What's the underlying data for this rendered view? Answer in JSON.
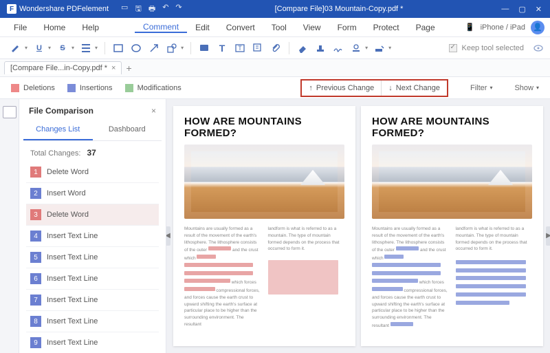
{
  "titlebar": {
    "app": "Wondershare PDFelement",
    "doc": "[Compare File]03 Mountain-Copy.pdf *"
  },
  "menu": {
    "items": [
      "File",
      "Home",
      "Help",
      "Comment",
      "Edit",
      "Convert",
      "Tool",
      "View",
      "Form",
      "Protect",
      "Page"
    ],
    "active": "Comment",
    "device": "iPhone / iPad"
  },
  "toolbar": {
    "keep": "Keep tool selected"
  },
  "tab": {
    "name": "[Compare  File...in-Copy.pdf *"
  },
  "legend": {
    "del": "Deletions",
    "ins": "Insertions",
    "mod": "Modifications"
  },
  "nav": {
    "prev": "Previous Change",
    "next": "Next Change",
    "filter": "Filter",
    "show": "Show"
  },
  "panel": {
    "title": "File Comparison",
    "tabs": [
      "Changes List",
      "Dashboard"
    ],
    "total_label": "Total Changes:",
    "total": "37",
    "changes": [
      {
        "n": "1",
        "type": "del",
        "label": "Delete Word"
      },
      {
        "n": "2",
        "type": "ins",
        "label": "Insert Word"
      },
      {
        "n": "3",
        "type": "del",
        "label": "Delete Word"
      },
      {
        "n": "4",
        "type": "ins",
        "label": "Insert Text Line"
      },
      {
        "n": "5",
        "type": "ins",
        "label": "Insert Text Line"
      },
      {
        "n": "6",
        "type": "ins",
        "label": "Insert Text Line"
      },
      {
        "n": "7",
        "type": "ins",
        "label": "Insert Text Line"
      },
      {
        "n": "8",
        "type": "ins",
        "label": "Insert Text Line"
      },
      {
        "n": "9",
        "type": "ins",
        "label": "Insert Text Line"
      }
    ]
  },
  "doc": {
    "heading": "HOW ARE MOUNTAINS FORMED?",
    "p1": "Mountains are usually formed as a result of the movement of the earth's lithosphere. The lithosphere consists of the outer",
    "p1b": "and the crust which",
    "p1c": "which forces",
    "p1d": "compressional forces, and forces cause the earth crust to upward shifting the earth's surface at particular place to be higher than the surrounding environment. The resultant",
    "p2": "landform is what is referred to as a mountain. The type of mountain formed depends on the process that occurred to form it."
  }
}
